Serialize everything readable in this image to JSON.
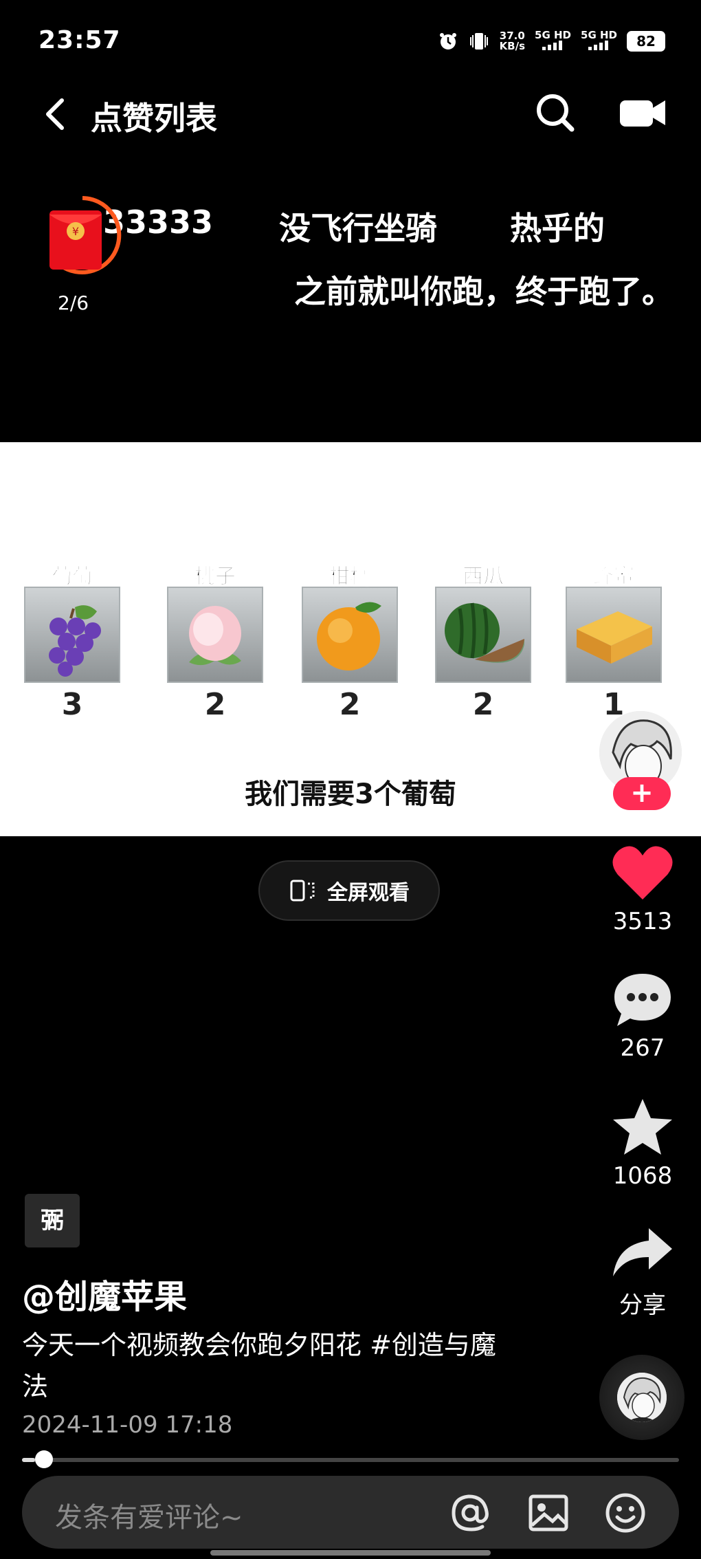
{
  "status_bar": {
    "time": "23:57",
    "net_speed_value": "37.0",
    "net_speed_unit": "KB/s",
    "sim1": "5G HD",
    "sim2": "5G HD",
    "battery": "82",
    "icons": [
      "alarm-icon",
      "vibrate-icon"
    ]
  },
  "header": {
    "title": "点赞列表",
    "icons": [
      "back-icon",
      "search-icon",
      "camera-icon"
    ]
  },
  "danmaku": [
    "33333",
    "没飞行坐骑",
    "热乎的",
    "之前就叫你跑，终于跑了。"
  ],
  "red_packet": {
    "count": "2/6"
  },
  "video": {
    "fruits": [
      {
        "name": "葡萄",
        "count": "3",
        "icon": "grape-icon"
      },
      {
        "name": "桃子",
        "count": "2",
        "icon": "peach-icon"
      },
      {
        "name": "柑橘",
        "count": "2",
        "icon": "orange-icon"
      },
      {
        "name": "西瓜",
        "count": "2",
        "icon": "watermelon-icon"
      },
      {
        "name": "蜂蜜",
        "count": "1",
        "icon": "honey-icon"
      }
    ],
    "subtitle": "我们需要3个葡萄",
    "fullscreen_label": "全屏观看",
    "follow_symbol": "+"
  },
  "rail": {
    "likes": "3513",
    "comments": "267",
    "favorites": "1068",
    "share_label": "分享",
    "like_color": "#ff2c55"
  },
  "post": {
    "tag": "弻",
    "username": "@创魔苹果",
    "description": "今天一个视频教会你跑夕阳花 #创造与魔法",
    "date": "2024-11-09 17:18",
    "progress": 0.02
  },
  "comment": {
    "placeholder": "发条有爱评论~",
    "icons": [
      "at-icon",
      "image-icon",
      "emoji-icon"
    ]
  }
}
